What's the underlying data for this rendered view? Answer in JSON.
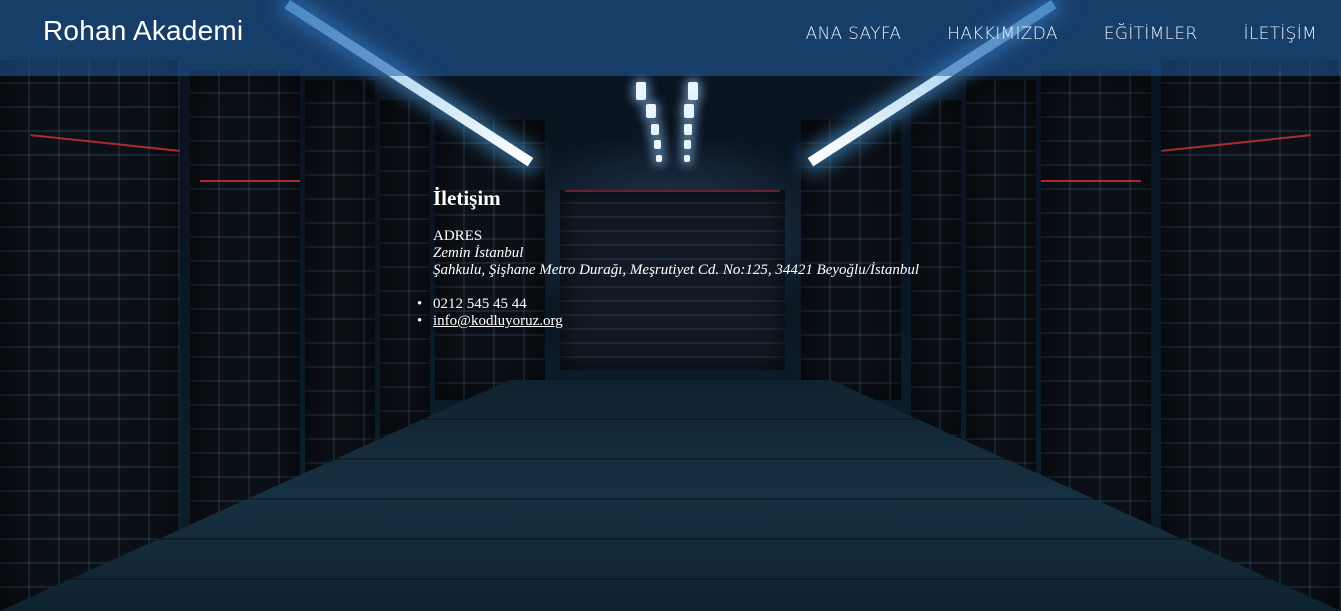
{
  "brand": "Rohan Akademi",
  "nav": {
    "items": [
      "ANA SAYFA",
      "HAKKIMIZDA",
      "EĞİTİMLER",
      "İLETİŞİM"
    ]
  },
  "contact": {
    "heading": "İletişim",
    "address_label": "ADRES",
    "place_name": "Zemin İstanbul",
    "street": "Şahkulu, Şişhane Metro Durağı, Meşrutiyet Cd. No:125, 34421 Beyoğlu/İstanbul",
    "phone": "0212 545 45 44",
    "email": "info@kodluyoruz.org"
  },
  "colors": {
    "navbar": "#235fa5",
    "text": "#ffffff"
  }
}
